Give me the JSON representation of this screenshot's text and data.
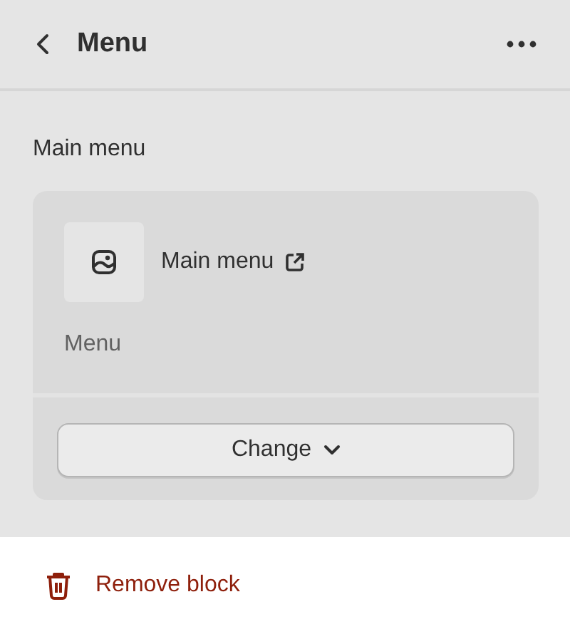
{
  "header": {
    "title": "Menu"
  },
  "section": {
    "label": "Main menu"
  },
  "card": {
    "link_title": "Main menu",
    "subtitle": "Menu",
    "button": "Change"
  },
  "footer": {
    "action": "Remove block"
  }
}
